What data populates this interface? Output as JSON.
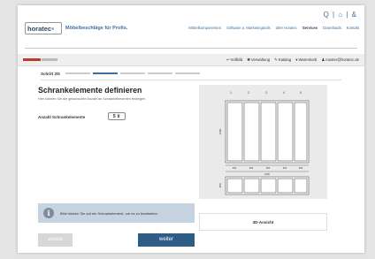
{
  "header": {
    "top_icons": "Q | ⌂ | &",
    "logo_text": "horatec",
    "logo_reg": "®",
    "claim": "Möbelbeschläge für Profis.",
    "nav": [
      "Möbelkomponenten",
      "Software u. Marketingtools",
      "über Horatec",
      "Services",
      "Downloads",
      "Kontakt"
    ],
    "nav_active_index": 3
  },
  "util_bar": {
    "items": [
      {
        "icon": "arrow-icon",
        "glyph": "↩",
        "label": "Vollbild"
      },
      {
        "icon": "gear-icon",
        "glyph": "✱",
        "label": "Verwaltung"
      },
      {
        "icon": "catalog-icon",
        "glyph": "✎",
        "label": "Katalog"
      },
      {
        "icon": "cart-icon",
        "glyph": "▾",
        "label": "Warenkorb"
      },
      {
        "icon": "user-icon",
        "glyph": "♟",
        "label": "muster@horatec.de"
      }
    ]
  },
  "step": {
    "label": "Schritt 2/5",
    "current": 2,
    "total": 5
  },
  "main": {
    "title": "Schrankelemente definieren",
    "subtitle": "Hier können Sie die gewünschte Anzahl an Schrankelementen festlegen.",
    "field_label": "Anzahl Schrankelemente",
    "field_value": "5"
  },
  "drawing": {
    "column_numbers": [
      "1",
      "2",
      "3",
      "4",
      "5"
    ],
    "height_label": "2200",
    "base_label": "450",
    "width_labels": [
      "460",
      "460",
      "460",
      "460",
      "460"
    ],
    "total_width": "2300"
  },
  "info": {
    "icon_glyph": "i",
    "text": "Bitte klicken Sie auf ein Schrankelement, um es zu bearbeiten."
  },
  "buttons": {
    "view3d": "3D-Ansicht",
    "back": "zurück",
    "next": "weiter"
  },
  "colors": {
    "accent": "#2f5c86",
    "brand_red": "#c0392b",
    "info_bg": "#c6d4e1"
  }
}
